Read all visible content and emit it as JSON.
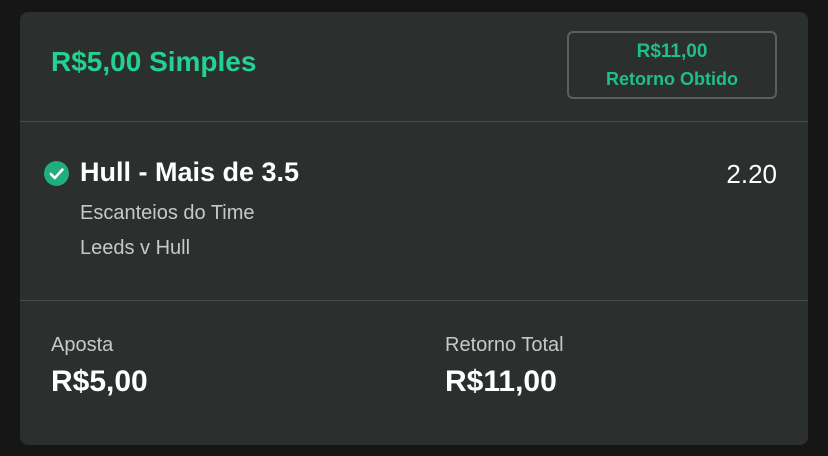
{
  "header": {
    "bet_title": "R$5,00 Simples",
    "returned_amount": "R$11,00",
    "returned_label": "Retorno Obtido"
  },
  "selection": {
    "status_icon": "check-circle-icon",
    "name": "Hull - Mais de 3.5",
    "odds": "2.20",
    "market": "Escanteios do Time",
    "event": "Leeds v Hull"
  },
  "footer": {
    "stake_label": "Aposta",
    "stake_value": "R$5,00",
    "total_return_label": "Retorno Total",
    "total_return_value": "R$11,00"
  },
  "colors": {
    "accent": "#22d292",
    "card_bg": "#2b2f2d",
    "page_bg": "#161616"
  }
}
